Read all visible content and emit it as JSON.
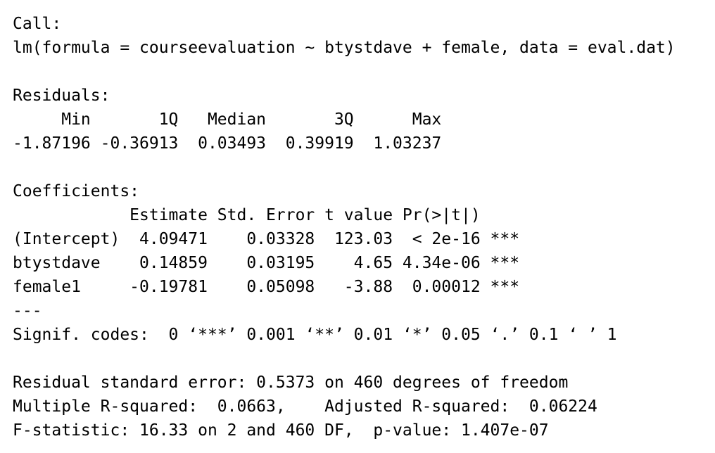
{
  "call": {
    "header": "Call:",
    "formula": "lm(formula = courseevaluation ~ btystdave + female, data = eval.dat)"
  },
  "residuals": {
    "header": "Residuals:",
    "labels_row": "     Min       1Q   Median       3Q      Max ",
    "values_row": "-1.87196 -0.36913  0.03493  0.39919  1.03237 "
  },
  "coefficients": {
    "header": "Coefficients:",
    "column_header": "            Estimate Std. Error t value Pr(>|t|)    ",
    "rows": [
      "(Intercept)  4.09471    0.03328  123.03  < 2e-16 ***",
      "btystdave    0.14859    0.03195    4.65 4.34e-06 ***",
      "female1     -0.19781    0.05098   -3.88  0.00012 ***"
    ],
    "separator": "---",
    "signif_codes": "Signif. codes:  0 ‘***’ 0.001 ‘**’ 0.01 ‘*’ 0.05 ‘.’ 0.1 ‘ ’ 1"
  },
  "summary": {
    "residual_se": "Residual standard error: 0.5373 on 460 degrees of freedom",
    "r_squared": "Multiple R-squared:  0.0663,    Adjusted R-squared:  0.06224 ",
    "f_statistic": "F-statistic: 16.33 on 2 and 460 DF,  p-value: 1.407e-07"
  }
}
